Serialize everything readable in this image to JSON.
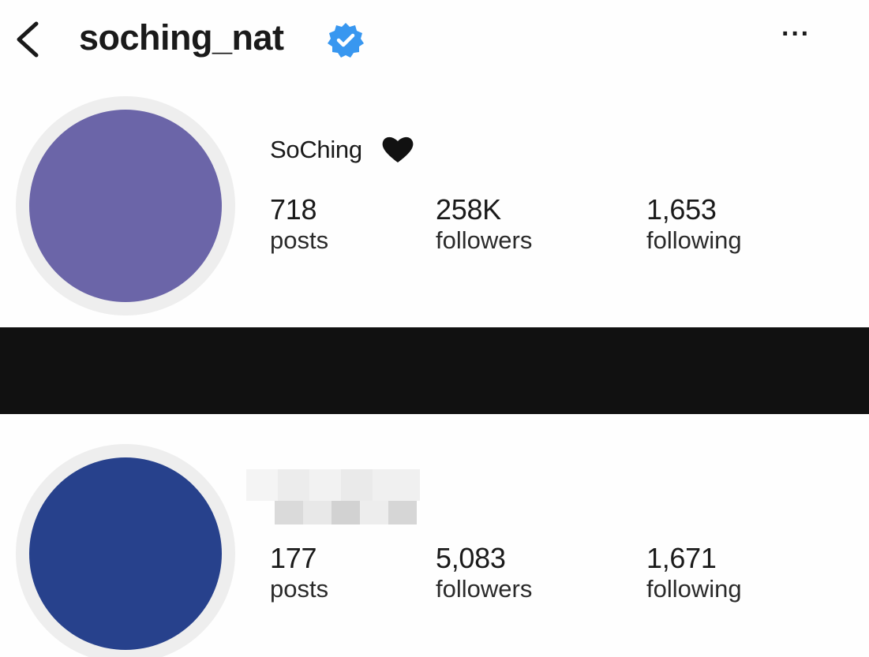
{
  "header": {
    "username": "soching_nat",
    "back_icon": "chevron-left-icon",
    "verified_icon": "verified-badge-icon",
    "more_icon": "more-horizontal-icon",
    "more_glyph": "···",
    "verified_color": "#3897f0"
  },
  "profiles": [
    {
      "display_name": "SoChing",
      "name_icon": "black-heart-icon",
      "avatar_color": "#6b65a8",
      "stats": {
        "posts": {
          "value": "718",
          "label": "posts"
        },
        "followers": {
          "value": "258K",
          "label": "followers"
        },
        "following": {
          "value": "1,653",
          "label": "following"
        }
      }
    },
    {
      "display_name_state": "pixelated / obscured",
      "avatar_color": "#27418c",
      "stats": {
        "posts": {
          "value": "177",
          "label": "posts"
        },
        "followers": {
          "value": "5,083",
          "label": "followers"
        },
        "following": {
          "value": "1,671",
          "label": "following"
        }
      }
    }
  ],
  "divider_color": "#111111"
}
